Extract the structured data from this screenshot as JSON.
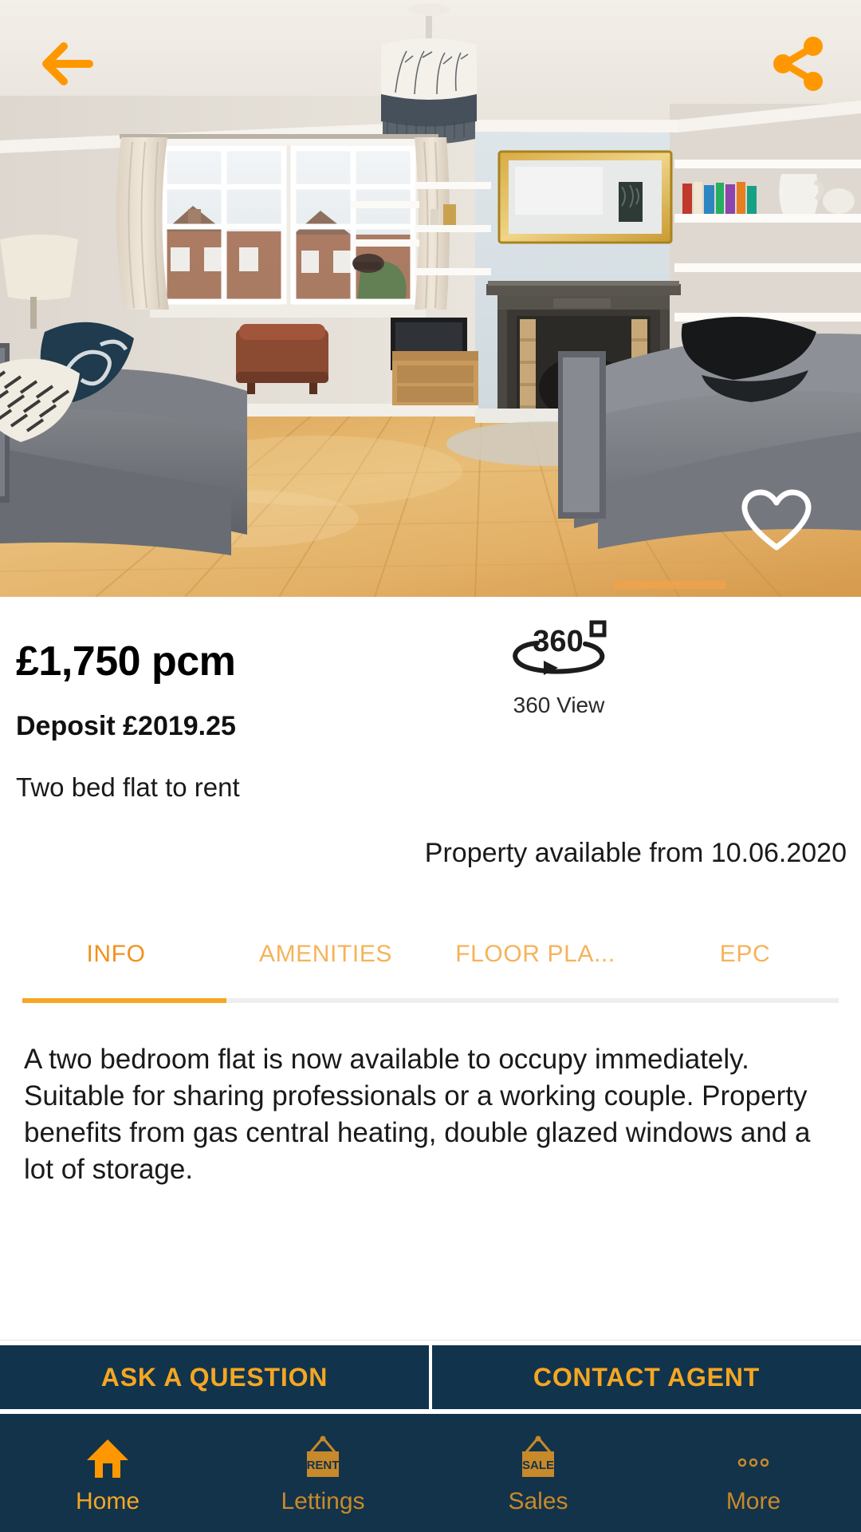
{
  "colors": {
    "accent_orange": "#f5a623",
    "accent_orange_bright": "#ff9800",
    "tab_inactive": "#f5b35a",
    "tab_active": "#f0911e",
    "navy": "#13334a",
    "cta_navy": "#11344c",
    "nav_label": "#c8892a",
    "text_dark": "#1a1a1a"
  },
  "hero": {
    "alt": "Living room with wooden floor, grey sofas, fireplace with gold mirror and white alcove shelving",
    "back_icon": "back-arrow-icon",
    "share_icon": "share-icon",
    "favorite_icon": "heart-outline-icon"
  },
  "listing": {
    "price": "£1,750 pcm",
    "deposit": "Deposit £2019.25",
    "subtitle": "Two bed flat to rent",
    "availability": "Property available from 10.06.2020"
  },
  "view360": {
    "icon": "360-rotate-icon",
    "badge": "360",
    "degree_symbol": "°",
    "label": "360 View"
  },
  "tabs": {
    "active_index": 0,
    "items": [
      {
        "label": "INFO"
      },
      {
        "label": "AMENITIES"
      },
      {
        "label": "FLOOR PLA..."
      },
      {
        "label": "EPC"
      }
    ]
  },
  "description": {
    "text": "A two bedroom flat is now available to occupy immediately. Suitable for sharing professionals or a working couple. Property benefits from gas central heating, double glazed windows and a lot of storage."
  },
  "cta": {
    "ask_label": "ASK A QUESTION",
    "contact_label": "CONTACT AGENT"
  },
  "bottom_nav": {
    "active_index": 0,
    "items": [
      {
        "label": "Home",
        "icon": "home-icon"
      },
      {
        "label": "Lettings",
        "icon": "rent-sign-icon",
        "sign_text": "RENT"
      },
      {
        "label": "Sales",
        "icon": "sale-sign-icon",
        "sign_text": "SALE"
      },
      {
        "label": "More",
        "icon": "more-dots-icon"
      }
    ]
  }
}
